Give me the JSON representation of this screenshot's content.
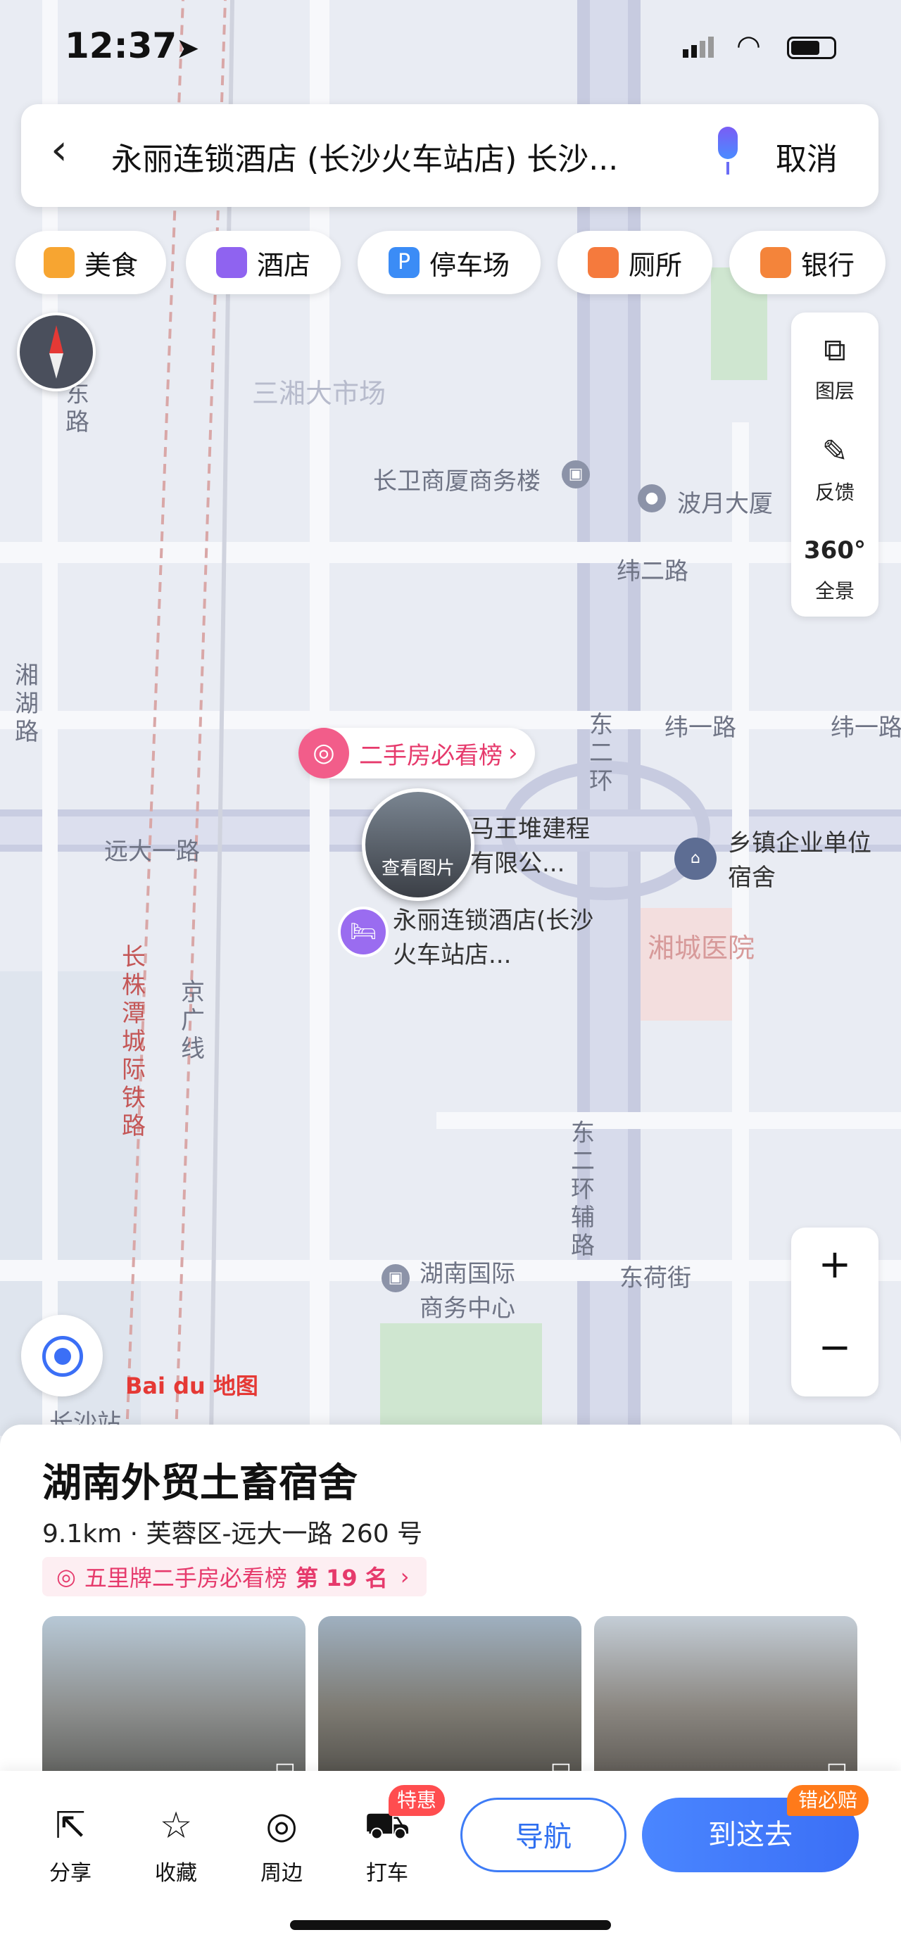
{
  "status_bar": {
    "time": "12:37"
  },
  "search": {
    "query": "永丽连锁酒店 (长沙火车站店) 长沙...",
    "cancel_label": "取消"
  },
  "categories": [
    {
      "label": "美食",
      "color": "#f7a531"
    },
    {
      "label": "酒店",
      "color": "#8f63f0"
    },
    {
      "label": "停车场",
      "color": "#3b8cf6"
    },
    {
      "label": "厕所",
      "color": "#f57a3d"
    },
    {
      "label": "银行",
      "color": "#f4843a"
    }
  ],
  "tools": {
    "layers": "图层",
    "feedback": "反馈",
    "panorama": "全景",
    "panorama_icon": "360°"
  },
  "map": {
    "labels": {
      "market": "三湘大市场",
      "office_tower": "长卫商厦商务楼",
      "bo_yue": "波月大厦",
      "weier_road": "纬二路",
      "weiyi_road_1": "纬一路",
      "weiyi_road_2": "纬一路",
      "yuanda_road": "远大一路",
      "xianghu_road": "湘湖路",
      "dongerhuan": "东二环",
      "mawangdui": "马王堆建程有限公...",
      "hotel": "永丽连锁酒店(长沙火车站店...",
      "xiangzhen": "乡镇企业单位宿舍",
      "xiangcheng_hospital": "湘城医院",
      "rail_line": "长株潭城际铁路",
      "jingguang": "京广线",
      "dongerhuan_fu": "东二环辅路",
      "donghe_street": "东荷街",
      "hunan_intl": "湖南国际商务中心",
      "dong_road": "东路",
      "changsha_station": "长沙站"
    },
    "second_hand_tag": "二手房必看榜",
    "photo_caption": "查看图片",
    "logo": "Bai du 地图"
  },
  "sheet": {
    "title": "湖南外贸土畜宿舍",
    "info": "9.1km · 芙蓉区-远大一路 260 号",
    "rank_text": "五里牌二手房必看榜",
    "rank_value": "第 19 名"
  },
  "actions": {
    "share": "分享",
    "favorite": "收藏",
    "nearby": "周边",
    "taxi": "打车",
    "taxi_badge": "特惠",
    "navigate": "导航",
    "go_here": "到这去",
    "go_badge": "错必赔"
  },
  "colors": {
    "accent": "#3b6ff6",
    "pink": "#e63a6c",
    "orange": "#ff7a1a"
  }
}
